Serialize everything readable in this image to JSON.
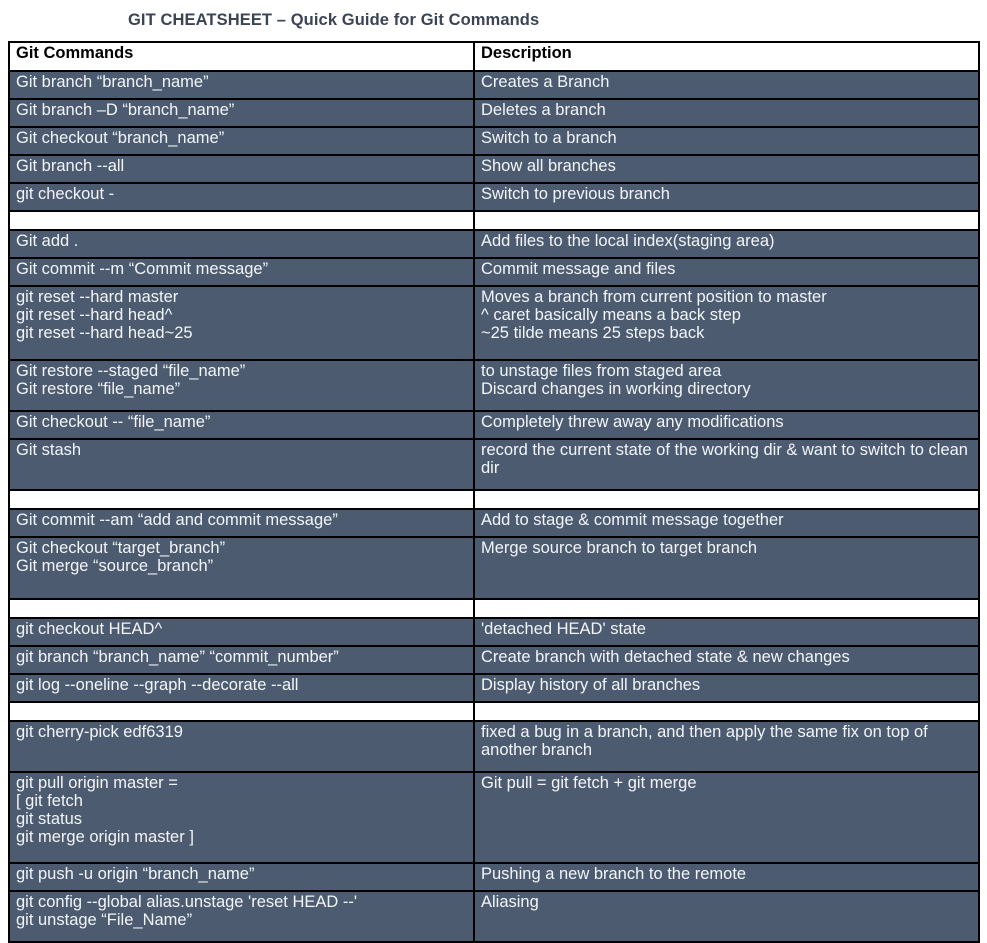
{
  "document": {
    "title": "GIT CHEATSHEET – Quick Guide for Git Commands",
    "colors": {
      "row_background": "#4c5b70",
      "row_text": "#f2f5f8",
      "header_background": "#ffffff",
      "header_text": "#000000",
      "border": "#000000",
      "title_text": "#3b4455",
      "page_background": "#ffffff"
    }
  },
  "table": {
    "headers": {
      "commands": "Git Commands",
      "description": "Description"
    },
    "rows": [
      {
        "type": "data",
        "command": "Git branch “branch_name”",
        "description": "Creates a Branch"
      },
      {
        "type": "data",
        "command": "Git branch –D “branch_name”",
        "description": "Deletes a branch"
      },
      {
        "type": "data",
        "command": "Git checkout “branch_name”",
        "description": "Switch to a branch"
      },
      {
        "type": "data",
        "command": "Git branch --all",
        "description": "Show all branches"
      },
      {
        "type": "data",
        "command": "git checkout -",
        "description": "Switch to previous branch"
      },
      {
        "type": "spacer",
        "command": "",
        "description": ""
      },
      {
        "type": "data",
        "command": "Git add .",
        "description": "Add files to the local index(staging area)"
      },
      {
        "type": "data",
        "command": "Git commit --m “Commit message”",
        "description": "Commit message and files"
      },
      {
        "type": "data",
        "command": "git reset --hard master\ngit reset --hard head^\ngit reset --hard head~25",
        "description": "Moves a branch from current position to master\n^ caret basically means a back step\n~25 tilde means 25 steps back"
      },
      {
        "type": "data",
        "command": "Git restore --staged “file_name”\nGit restore  “file_name”",
        "description": "to unstage files from staged area\nDiscard changes in working directory"
      },
      {
        "type": "data",
        "command": "Git checkout -- “file_name”",
        "description": "Completely threw away any modifications"
      },
      {
        "type": "data",
        "command": "Git stash",
        "description": "record the current state of the working dir & want to switch to clean dir"
      },
      {
        "type": "spacer",
        "command": "",
        "description": ""
      },
      {
        "type": "data",
        "command": "Git commit --am “add and commit message”",
        "description": "Add to stage & commit message together"
      },
      {
        "type": "data",
        "command": "Git checkout “target_branch”\nGit merge “source_branch”",
        "description": "Merge source branch to target branch"
      },
      {
        "type": "spacer",
        "command": "",
        "description": ""
      },
      {
        "type": "data",
        "command": "git checkout HEAD^",
        "description": "'detached HEAD' state"
      },
      {
        "type": "data",
        "command": "git branch “branch_name” “commit_number”",
        "description": "Create branch with detached state & new changes"
      },
      {
        "type": "data",
        "command": "git log --oneline --graph --decorate --all",
        "description": "Display history of all branches"
      },
      {
        "type": "spacer",
        "command": "",
        "description": ""
      },
      {
        "type": "data",
        "command": "git cherry-pick edf6319",
        "description": "fixed a bug in a branch, and then apply the same fix on top of another branch"
      },
      {
        "type": "data",
        "command": "git pull origin master =\n[  git fetch\n    git status\n    git merge origin master ]",
        "description": "Git pull = git fetch + git merge"
      },
      {
        "type": "data",
        "command": "git push -u origin “branch_name”",
        "description": "Pushing a new branch to the remote"
      },
      {
        "type": "data",
        "command": "git config --global alias.unstage 'reset HEAD --'\ngit unstage “File_Name”",
        "description": "Aliasing"
      }
    ]
  }
}
